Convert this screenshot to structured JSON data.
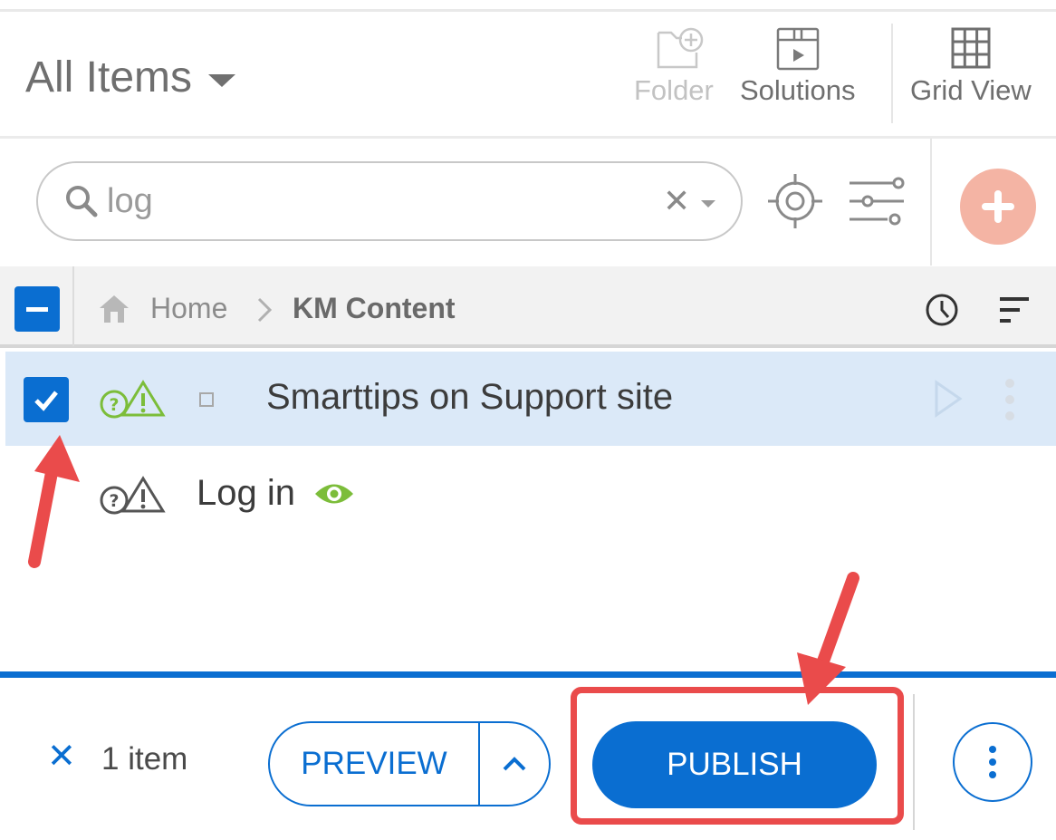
{
  "header": {
    "title": "All Items",
    "toolbar": {
      "folder_label": "Folder",
      "solutions_label": "Solutions",
      "grid_view_label": "Grid View"
    }
  },
  "search": {
    "value": "log"
  },
  "breadcrumb": {
    "home": "Home",
    "current": "KM Content"
  },
  "items": [
    {
      "title": "Smarttips on Support site",
      "selected": true
    },
    {
      "title": "Log in",
      "selected": false
    }
  ],
  "action_bar": {
    "selected_count": "1 item",
    "preview_label": "PREVIEW",
    "publish_label": "PUBLISH"
  },
  "colors": {
    "accent": "#0a6ed1",
    "add_button": "#f4b4a4",
    "selected_row": "#dbe9f8",
    "annotation": "#ea4b4b",
    "status_green": "#7cbd3a"
  }
}
